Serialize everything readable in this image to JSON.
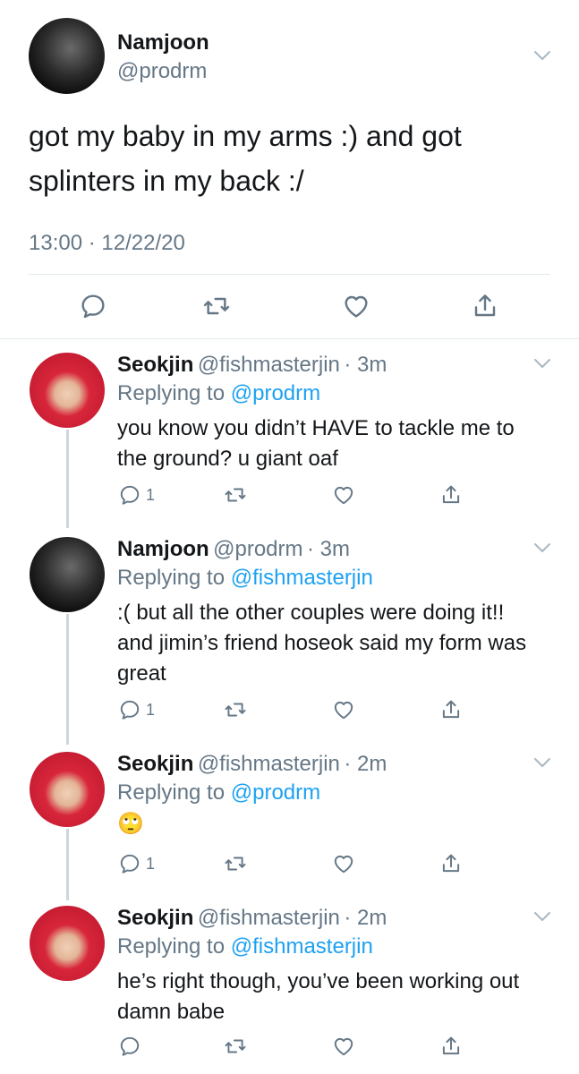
{
  "main_tweet": {
    "name": "Namjoon",
    "handle": "@prodrm",
    "text_line1": "got my baby in my arms :) and got",
    "text_line2": "splinters in my back :/",
    "timestamp": "13:00 · 12/22/20"
  },
  "replies": [
    {
      "name": "Seokjin",
      "handle": "@fishmasterjin",
      "time": "· 3m",
      "replying_prefix": "Replying to",
      "replying_to": "@prodrm",
      "lines": [
        "you know you didn’t HAVE to tackle me to",
        "the ground? u giant oaf"
      ],
      "reply_count": "1"
    },
    {
      "name": "Namjoon",
      "handle": "@prodrm",
      "time": "· 3m",
      "replying_prefix": "Replying to",
      "replying_to": "@fishmasterjin",
      "lines": [
        ":( but all the other couples were doing it!!",
        "and jimin’s friend hoseok said my form was",
        "great"
      ],
      "reply_count": "1"
    },
    {
      "name": "Seokjin",
      "handle": "@fishmasterjin",
      "time": "· 2m",
      "replying_prefix": "Replying to",
      "replying_to": "@prodrm",
      "lines": [
        "🙄"
      ],
      "reply_count": "1"
    },
    {
      "name": "Seokjin",
      "handle": "@fishmasterjin",
      "time": "· 2m",
      "replying_prefix": "Replying to",
      "replying_to": "@fishmasterjin",
      "lines": [
        "he’s right though, you’ve been working out",
        "damn babe"
      ],
      "reply_count": ""
    }
  ],
  "colors": {
    "link": "#1da1f2",
    "muted": "#657786",
    "thread_line": "#ccd6dd"
  },
  "icons": [
    "reply-icon",
    "retweet-icon",
    "like-icon",
    "share-icon",
    "chevron-down-icon"
  ]
}
